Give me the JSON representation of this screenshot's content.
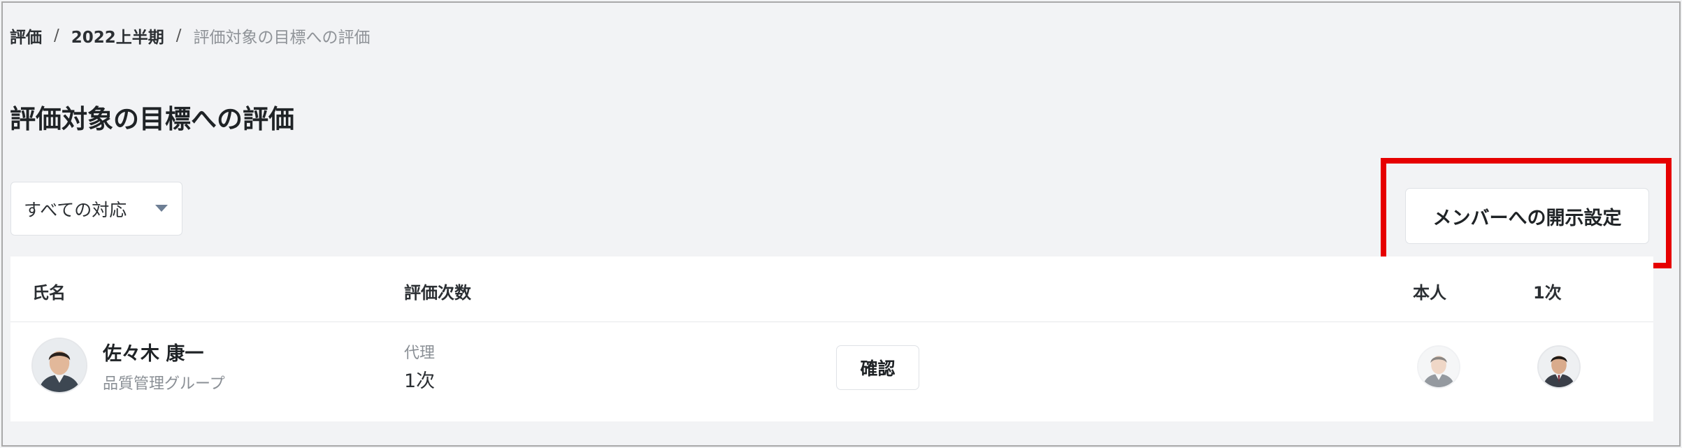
{
  "breadcrumb": {
    "items": [
      "評価",
      "2022上半期"
    ],
    "separator": "/",
    "current": "評価対象の目標への評価"
  },
  "page": {
    "title": "評価対象の目標への評価"
  },
  "filter": {
    "selected": "すべての対応"
  },
  "actions": {
    "disclose_label": "メンバーへの開示設定"
  },
  "table": {
    "columns": [
      "氏名",
      "評価次数",
      "本人",
      "1次"
    ],
    "rows": [
      {
        "name": "佐々木 康一",
        "department": "品質管理グループ",
        "role": "代理",
        "stage": "1次",
        "action_label": "確認"
      }
    ]
  },
  "colors": {
    "highlight": "#e60000",
    "background": "#f2f3f5",
    "caret": "#6d7e94"
  }
}
